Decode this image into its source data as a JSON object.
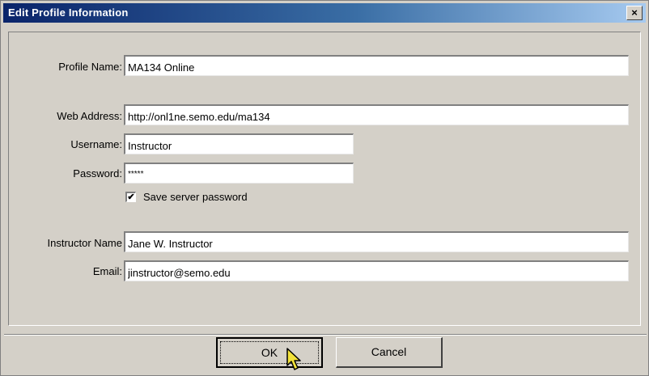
{
  "window": {
    "title": "Edit Profile Information",
    "close_glyph": "×"
  },
  "form": {
    "profile_name": {
      "label": "Profile Name:",
      "value": "MA134 Online"
    },
    "web_address": {
      "label": "Web Address:",
      "value": "http://onl1ne.semo.edu/ma134"
    },
    "username": {
      "label": "Username:",
      "value": "Instructor"
    },
    "password": {
      "label": "Password:",
      "value": "*****"
    },
    "save_password": {
      "label": "Save server password",
      "checked": true,
      "glyph": "✔"
    },
    "instructor_name": {
      "label": "Instructor Name",
      "value": "Jane W. Instructor"
    },
    "email": {
      "label": "Email:",
      "value": "jinstructor@semo.edu"
    }
  },
  "buttons": {
    "ok": "OK",
    "cancel": "Cancel"
  }
}
